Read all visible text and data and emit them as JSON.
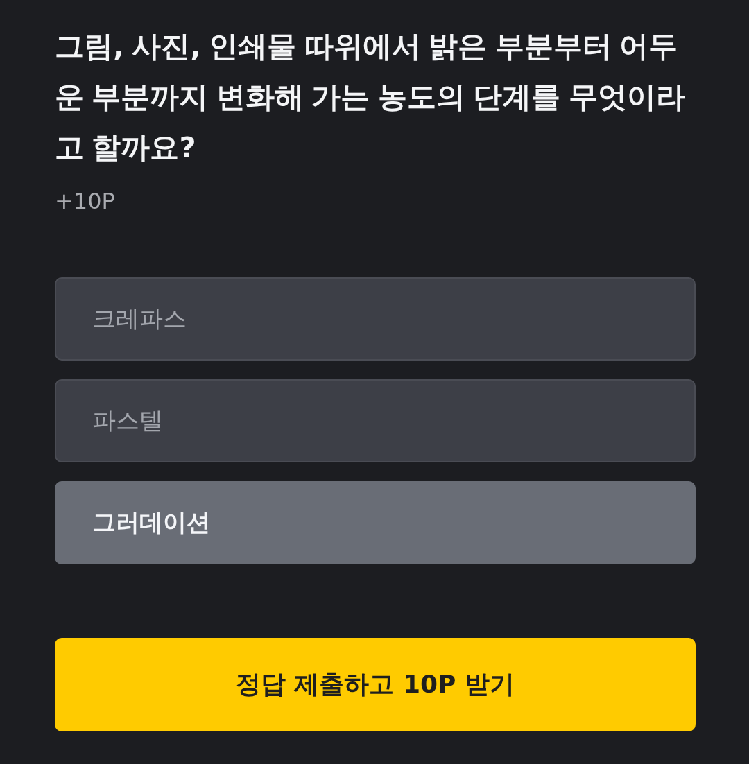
{
  "question": {
    "text": "그림, 사진, 인쇄물 따위에서 밝은 부분부터 어두운 부분까지 변화해 가는 농도의 단계를 무엇이라고 할까요?",
    "points": "+10P"
  },
  "options": [
    {
      "label": "크레파스",
      "selected": false
    },
    {
      "label": "파스텔",
      "selected": false
    },
    {
      "label": "그러데이션",
      "selected": true
    }
  ],
  "submit_button": {
    "label": "정답 제출하고 10P 받기"
  }
}
